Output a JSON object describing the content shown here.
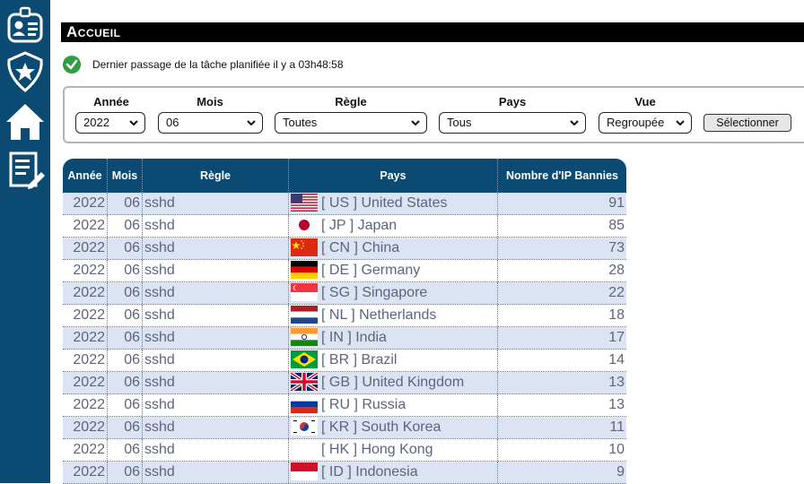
{
  "page": {
    "title": "Accueil"
  },
  "status": {
    "text": "Dernier passage de la tâche planifiée il y a 03h48:58"
  },
  "sidebar": {
    "icons": [
      "user-card-icon",
      "police-badge-icon",
      "home-icon",
      "report-edit-icon"
    ]
  },
  "filters": {
    "annee": {
      "label": "Année",
      "value": "2022"
    },
    "mois": {
      "label": "Mois",
      "value": "06"
    },
    "regle": {
      "label": "Règle",
      "value": "Toutes"
    },
    "pays": {
      "label": "Pays",
      "value": "Tous"
    },
    "vue": {
      "label": "Vue",
      "value": "Regroupée"
    },
    "submit_label": "Sélectionner"
  },
  "table": {
    "headers": [
      "Année",
      "Mois",
      "Règle",
      "Pays",
      "Nombre d'IP Bannies"
    ],
    "rows": [
      {
        "annee": "2022",
        "mois": "06",
        "regle": "sshd",
        "pays": "[ US ] United States",
        "flag": "us",
        "count": "91"
      },
      {
        "annee": "2022",
        "mois": "06",
        "regle": "sshd",
        "pays": "[ JP ] Japan",
        "flag": "jp",
        "count": "85"
      },
      {
        "annee": "2022",
        "mois": "06",
        "regle": "sshd",
        "pays": "[ CN ] China",
        "flag": "cn",
        "count": "73"
      },
      {
        "annee": "2022",
        "mois": "06",
        "regle": "sshd",
        "pays": "[ DE ] Germany",
        "flag": "de",
        "count": "28"
      },
      {
        "annee": "2022",
        "mois": "06",
        "regle": "sshd",
        "pays": "[ SG ] Singapore",
        "flag": "sg",
        "count": "22"
      },
      {
        "annee": "2022",
        "mois": "06",
        "regle": "sshd",
        "pays": "[ NL ] Netherlands",
        "flag": "nl",
        "count": "18"
      },
      {
        "annee": "2022",
        "mois": "06",
        "regle": "sshd",
        "pays": "[ IN ] India",
        "flag": "in",
        "count": "17"
      },
      {
        "annee": "2022",
        "mois": "06",
        "regle": "sshd",
        "pays": "[ BR ] Brazil",
        "flag": "br",
        "count": "14"
      },
      {
        "annee": "2022",
        "mois": "06",
        "regle": "sshd",
        "pays": "[ GB ] United Kingdom",
        "flag": "gb",
        "count": "13"
      },
      {
        "annee": "2022",
        "mois": "06",
        "regle": "sshd",
        "pays": "[ RU ] Russia",
        "flag": "ru",
        "count": "13"
      },
      {
        "annee": "2022",
        "mois": "06",
        "regle": "sshd",
        "pays": "[ KR ] South Korea",
        "flag": "kr",
        "count": "11"
      },
      {
        "annee": "2022",
        "mois": "06",
        "regle": "sshd",
        "pays": "[ HK ] Hong Kong",
        "flag": "",
        "count": "10"
      },
      {
        "annee": "2022",
        "mois": "06",
        "regle": "sshd",
        "pays": "[ ID ] Indonesia",
        "flag": "id",
        "count": "9"
      }
    ]
  },
  "colors": {
    "sidebar": "#0b4a73",
    "header": "#0b4a73",
    "row_alt": "#dce3f3",
    "text": "#5e6480",
    "check": "#2e9e3e"
  }
}
